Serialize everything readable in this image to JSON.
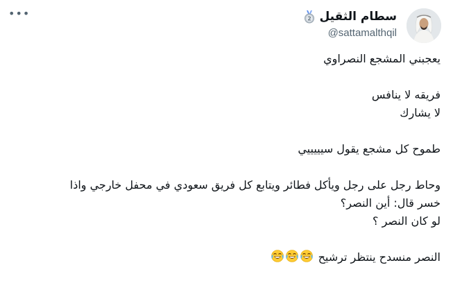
{
  "author": {
    "display_name": "سطام الثقيل",
    "handle": "@sattamalthqil",
    "badge": "medal-2-icon",
    "avatar": "profile-photo"
  },
  "more_icon": "more-horizontal-icon",
  "tweet": {
    "lines": [
      "يعجبني المشجع النصراوي",
      "",
      "فريقه لا ينافس",
      "لا يشارك",
      "",
      "طموح كل مشجع يقول سيييييي",
      "",
      "وحاط رجل على رجل ويأكل فطائر ويتابع كل فريق سعودي في محفل خارجي واذا",
      "خسر قال: أين النصر؟",
      "لو كان النصر ؟",
      "",
      "النصر منسدح ينتظر ترشيح"
    ],
    "trailing_emoji": [
      "face-with-tears-of-joy",
      "face-with-tears-of-joy",
      "face-with-tears-of-joy"
    ]
  }
}
